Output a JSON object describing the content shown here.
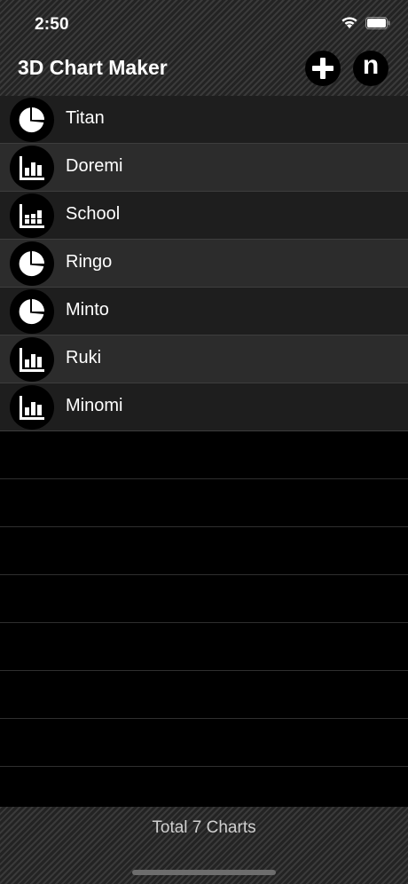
{
  "status_bar": {
    "time": "2:50"
  },
  "header": {
    "title": "3D Chart Maker",
    "add_icon": "plus-icon",
    "n_button_glyph": "n"
  },
  "charts": [
    {
      "name": "Titan",
      "icon": "pie-chart-icon"
    },
    {
      "name": "Doremi",
      "icon": "bar-chart-icon"
    },
    {
      "name": "School",
      "icon": "stacked-bar-chart-icon"
    },
    {
      "name": "Ringo",
      "icon": "pie-chart-icon"
    },
    {
      "name": "Minto",
      "icon": "pie-chart-icon"
    },
    {
      "name": "Ruki",
      "icon": "bar-chart-icon"
    },
    {
      "name": "Minomi",
      "icon": "bar-chart-icon"
    }
  ],
  "footer": {
    "total_text": "Total 7 Charts"
  }
}
